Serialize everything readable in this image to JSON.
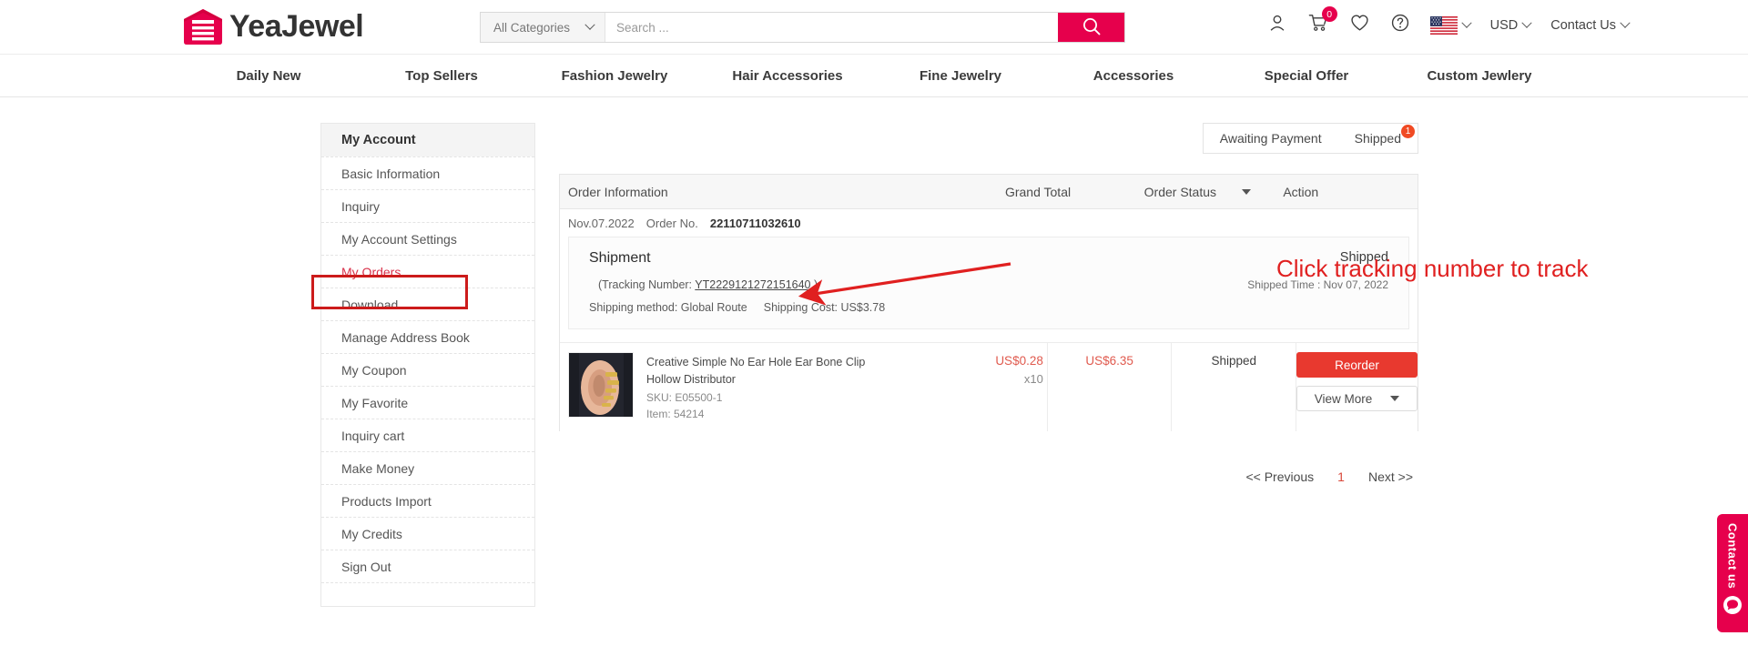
{
  "brand": {
    "name": "YeaJewel",
    "accent": "#e6004c",
    "logo_icon": "warehouse-logo-icon"
  },
  "header": {
    "category_select": "All Categories",
    "search_placeholder": "Search ...",
    "search_value": "",
    "search_icon": "search-icon",
    "account_icon": "user-account-icon",
    "cart_icon": "shopping-cart-icon",
    "cart_count": "0",
    "wishlist_icon": "heart-wishlist-icon",
    "help_icon": "question-help-icon",
    "flag_icon": "us-flag-icon",
    "currency": "USD",
    "contact": "Contact Us"
  },
  "nav": {
    "items": [
      {
        "label": "Daily New"
      },
      {
        "label": "Top Sellers"
      },
      {
        "label": "Fashion Jewelry"
      },
      {
        "label": "Hair Accessories"
      },
      {
        "label": "Fine Jewelry"
      },
      {
        "label": "Accessories"
      },
      {
        "label": "Special Offer"
      },
      {
        "label": "Custom Jewlery"
      }
    ]
  },
  "sidebar": {
    "title": "My Account",
    "items": [
      {
        "label": "Basic Information",
        "active": false
      },
      {
        "label": "Inquiry",
        "active": false
      },
      {
        "label": "My Account Settings",
        "active": false
      },
      {
        "label": "My Orders",
        "active": true
      },
      {
        "label": "Download",
        "active": false
      },
      {
        "label": "Manage Address Book",
        "active": false
      },
      {
        "label": "My Coupon",
        "active": false
      },
      {
        "label": "My Favorite",
        "active": false
      },
      {
        "label": "Inquiry cart",
        "active": false
      },
      {
        "label": "Make Money",
        "active": false
      },
      {
        "label": "Products Import",
        "active": false
      },
      {
        "label": "My Credits",
        "active": false
      },
      {
        "label": "Sign Out",
        "active": false
      }
    ]
  },
  "tabs": {
    "awaiting_payment": "Awaiting Payment",
    "shipped": "Shipped",
    "shipped_badge": "1"
  },
  "table": {
    "headers": {
      "order_information": "Order Information",
      "grand_total": "Grand Total",
      "order_status": "Order Status",
      "action": "Action"
    }
  },
  "order": {
    "date": "Nov.07.2022",
    "order_no_label": "Order No.",
    "order_no": "22110711032610",
    "shipment_title": "Shipment",
    "shipment_status": "Shipped",
    "tracking_prefix": "(Tracking Number:",
    "tracking_number": "YT2229121272151640",
    "tracking_suffix": ")",
    "shipped_time": "Shipped Time : Nov 07, 2022",
    "shipping_method": "Shipping method: Global Route",
    "shipping_cost": "Shipping Cost: US$3.78",
    "product": {
      "name_line1": "Creative Simple No Ear Hole Ear Bone Clip",
      "name_line2": "Hollow Distributor",
      "sku": "SKU: E05500-1",
      "item": "Item: 54214",
      "unit_price": "US$0.28",
      "quantity": "x10",
      "grand_total": "US$6.35",
      "status": "Shipped",
      "thumb_icon": "product-thumbnail-ear-cuff"
    },
    "actions": {
      "reorder": "Reorder",
      "view_more": "View More"
    }
  },
  "pagination": {
    "previous": "<< Previous",
    "current": "1",
    "next": "Next >>"
  },
  "annotations": {
    "callout_text": "Click tracking number to track",
    "callout_color": "#e02020"
  },
  "contact_widget": {
    "label": "Contact us",
    "icon": "chat-bubble-icon"
  }
}
